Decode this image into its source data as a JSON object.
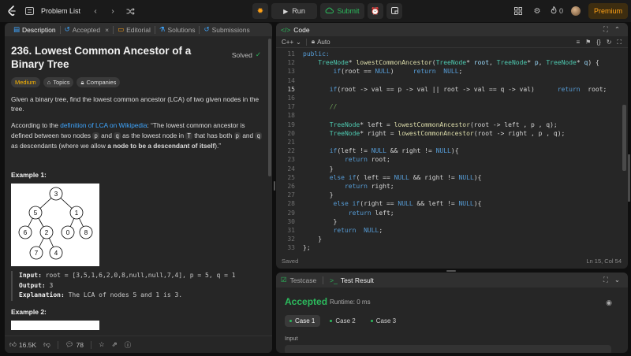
{
  "topbar": {
    "problem_list": "Problem List",
    "run": "Run",
    "submit": "Submit",
    "streak": "0",
    "premium": "Premium"
  },
  "left": {
    "tabs": [
      {
        "label": "Description"
      },
      {
        "label": "Accepted"
      },
      {
        "label": "Editorial"
      },
      {
        "label": "Solutions"
      },
      {
        "label": "Submissions"
      }
    ],
    "title": "236. Lowest Common Ancestor of a Binary Tree",
    "solved": "Solved",
    "tags": {
      "difficulty": "Medium",
      "topics": "Topics",
      "companies": "Companies"
    },
    "desc1": "Given a binary tree, find the lowest common ancestor (LCA) of two given nodes in the tree.",
    "desc2_prefix": "According to the ",
    "desc2_link": "definition of LCA on Wikipedia",
    "desc2_mid1": ": “The lowest common ancestor is defined between two nodes ",
    "p": "p",
    "and": " and ",
    "q": "q",
    "desc2_mid2": " as the lowest node in ",
    "T": "T",
    "desc2_mid3": " that has both ",
    "desc2_mid4": " as descendants (where we allow ",
    "desc2_bold": "a node to be a descendant of itself",
    "desc2_end": ").”",
    "example1_title": "Example 1:",
    "tree_nodes": [
      "3",
      "5",
      "1",
      "6",
      "2",
      "0",
      "8",
      "7",
      "4"
    ],
    "example1": {
      "input_label": "Input:",
      "input": " root = [3,5,1,6,2,0,8,null,null,7,4], p = 5, q = 1",
      "output_label": "Output:",
      "output": " 3",
      "explanation_label": "Explanation:",
      "explanation": " The LCA of nodes 5 and 1 is 3."
    },
    "example2_title": "Example 2:",
    "footer": {
      "likes": "16.5K",
      "comments": "78"
    }
  },
  "code": {
    "header": "Code",
    "language": "C++",
    "mode": "Auto",
    "saved": "Saved",
    "position": "Ln 15, Col 54",
    "lines": [
      {
        "n": "11",
        "segs": [
          [
            "kw",
            "public:"
          ]
        ]
      },
      {
        "n": "12",
        "segs": [
          [
            "",
            "    "
          ],
          [
            "ty",
            "TreeNode"
          ],
          [
            "",
            "* "
          ],
          [
            "fn",
            "lowestCommonAncestor"
          ],
          [
            "",
            "("
          ],
          [
            "ty",
            "TreeNode"
          ],
          [
            "",
            "* "
          ],
          [
            "vr",
            "root"
          ],
          [
            "",
            ", "
          ],
          [
            "ty",
            "TreeNode"
          ],
          [
            "",
            "* "
          ],
          [
            "vr",
            "p"
          ],
          [
            "",
            ", "
          ],
          [
            "ty",
            "TreeNode"
          ],
          [
            "",
            "* "
          ],
          [
            "vr",
            "q"
          ],
          [
            "",
            ") {"
          ]
        ]
      },
      {
        "n": "13",
        "segs": [
          [
            "",
            "        "
          ],
          [
            "kw",
            "if"
          ],
          [
            "",
            "(root == "
          ],
          [
            "kw",
            "NULL"
          ],
          [
            "",
            ")     "
          ],
          [
            "kw",
            "return"
          ],
          [
            "",
            "  "
          ],
          [
            "kw",
            "NULL"
          ],
          [
            "",
            ";"
          ]
        ]
      },
      {
        "n": "14",
        "segs": [
          [
            "",
            ""
          ]
        ]
      },
      {
        "n": "15",
        "segs": [
          [
            "",
            "       "
          ],
          [
            "kw",
            "if"
          ],
          [
            "",
            "(root -> val == p -> val || root -> val == q -> val)      "
          ],
          [
            "kw",
            "return"
          ],
          [
            "",
            "  root;"
          ]
        ]
      },
      {
        "n": "16",
        "segs": [
          [
            "",
            ""
          ]
        ]
      },
      {
        "n": "17",
        "segs": [
          [
            "",
            "       "
          ],
          [
            "cm",
            "//"
          ]
        ]
      },
      {
        "n": "18",
        "segs": [
          [
            "",
            ""
          ]
        ]
      },
      {
        "n": "19",
        "segs": [
          [
            "",
            "       "
          ],
          [
            "ty",
            "TreeNode"
          ],
          [
            "",
            "* left = "
          ],
          [
            "fn",
            "lowestCommonAncestor"
          ],
          [
            "",
            "(root -> left , p , q);"
          ]
        ]
      },
      {
        "n": "20",
        "segs": [
          [
            "",
            "       "
          ],
          [
            "ty",
            "TreeNode"
          ],
          [
            "",
            "* right = "
          ],
          [
            "fn",
            "lowestCommonAncestor"
          ],
          [
            "",
            "(root -> right , p , q);"
          ]
        ]
      },
      {
        "n": "21",
        "segs": [
          [
            "",
            ""
          ]
        ]
      },
      {
        "n": "22",
        "segs": [
          [
            "",
            "       "
          ],
          [
            "kw",
            "if"
          ],
          [
            "",
            "(left != "
          ],
          [
            "kw",
            "NULL"
          ],
          [
            "",
            " && right != "
          ],
          [
            "kw",
            "NULL"
          ],
          [
            "",
            "){"
          ]
        ]
      },
      {
        "n": "23",
        "segs": [
          [
            "",
            "           "
          ],
          [
            "kw",
            "return"
          ],
          [
            "",
            " root;"
          ]
        ]
      },
      {
        "n": "24",
        "segs": [
          [
            "",
            "       }"
          ]
        ]
      },
      {
        "n": "25",
        "segs": [
          [
            "",
            "       "
          ],
          [
            "kw",
            "else if"
          ],
          [
            "",
            "( left == "
          ],
          [
            "kw",
            "NULL"
          ],
          [
            "",
            " && right != "
          ],
          [
            "kw",
            "NULL"
          ],
          [
            "",
            "){"
          ]
        ]
      },
      {
        "n": "26",
        "segs": [
          [
            "",
            "           "
          ],
          [
            "kw",
            "return"
          ],
          [
            "",
            " right;"
          ]
        ]
      },
      {
        "n": "27",
        "segs": [
          [
            "",
            "       }"
          ]
        ]
      },
      {
        "n": "28",
        "segs": [
          [
            "",
            "        "
          ],
          [
            "kw",
            "else if"
          ],
          [
            "",
            "(right == "
          ],
          [
            "kw",
            "NULL"
          ],
          [
            "",
            " && left != "
          ],
          [
            "kw",
            "NULL"
          ],
          [
            "",
            "){"
          ]
        ]
      },
      {
        "n": "29",
        "segs": [
          [
            "",
            "            "
          ],
          [
            "kw",
            "return"
          ],
          [
            "",
            " left;"
          ]
        ]
      },
      {
        "n": "30",
        "segs": [
          [
            "",
            "        }"
          ]
        ]
      },
      {
        "n": "31",
        "segs": [
          [
            "",
            "        "
          ],
          [
            "kw",
            "return"
          ],
          [
            "",
            "  "
          ],
          [
            "kw",
            "NULL"
          ],
          [
            "",
            ";"
          ]
        ]
      },
      {
        "n": "32",
        "segs": [
          [
            "",
            "    }"
          ]
        ]
      },
      {
        "n": "33",
        "segs": [
          [
            "",
            "};"
          ]
        ]
      }
    ]
  },
  "test": {
    "tab_testcase": "Testcase",
    "tab_result": "Test Result",
    "status": "Accepted",
    "runtime": "Runtime: 0 ms",
    "cases": [
      "Case 1",
      "Case 2",
      "Case 3"
    ],
    "input_label": "Input"
  },
  "colors": {
    "accent": "#ffa116",
    "success": "#2cbb5d",
    "link": "#3ea6ff"
  }
}
